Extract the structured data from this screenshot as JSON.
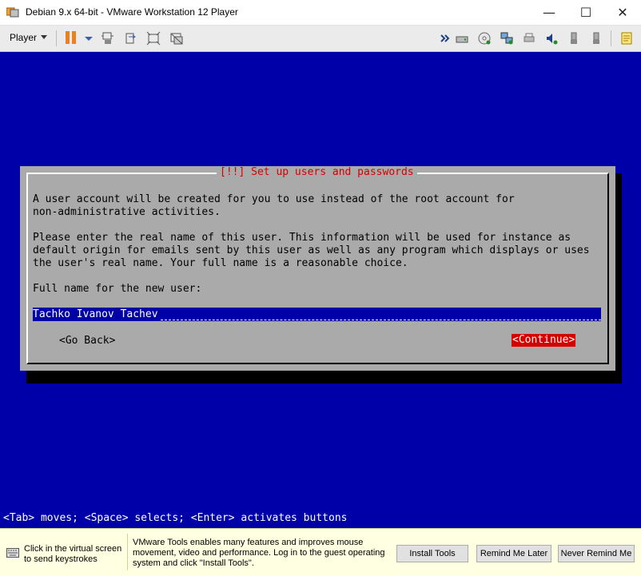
{
  "window": {
    "title": "Debian 9.x 64-bit - VMware Workstation 12 Player",
    "minimize_glyph": "—",
    "maximize_glyph": "☐",
    "close_glyph": "✕"
  },
  "toolbar": {
    "player_label": "Player",
    "icons": [
      "pause-icon",
      "pause-menu-arrow-icon",
      "send-ctrl-alt-del-icon",
      "fit-guest-icon",
      "full-screen-icon",
      "unity-icon",
      "more-devices-icon",
      "hard-disk-icon",
      "cd-dvd-icon",
      "network-adapter-icon",
      "printer-icon",
      "sound-card-icon",
      "usb-device-icon",
      "usb-device-2-icon",
      "message-log-icon"
    ]
  },
  "installer": {
    "title": "[!!] Set up users and passwords",
    "line1": "A user account will be created for you to use instead of the root account for",
    "line2": "non-administrative activities.",
    "line3": "Please enter the real name of this user. This information will be used for instance as",
    "line4": "default origin for emails sent by this user as well as any program which displays or uses",
    "line5": "the user's real name. Your full name is a reasonable choice.",
    "field_label": "Full name for the new user:",
    "field_value": "Tachko Ivanov Tachev",
    "go_back": "<Go Back>",
    "continue": "<Continue>",
    "status_line": "<Tab> moves; <Space> selects; <Enter> activates buttons"
  },
  "notification": {
    "click_text": "Click in the virtual screen to send keystrokes",
    "tools_text": "VMware Tools enables many features and improves mouse movement, video and performance. Log in to the guest operating system and click \"Install Tools\".",
    "install_button": "Install Tools",
    "later_button": "Remind Me Later",
    "never_button": "Never Remind Me"
  },
  "colors": {
    "vm_background": "#0000a8",
    "dialog_gray": "#aaaaaa",
    "dialog_title": "#d40000",
    "pause_orange": "#e8821e",
    "notify_background": "#ffffe1"
  }
}
